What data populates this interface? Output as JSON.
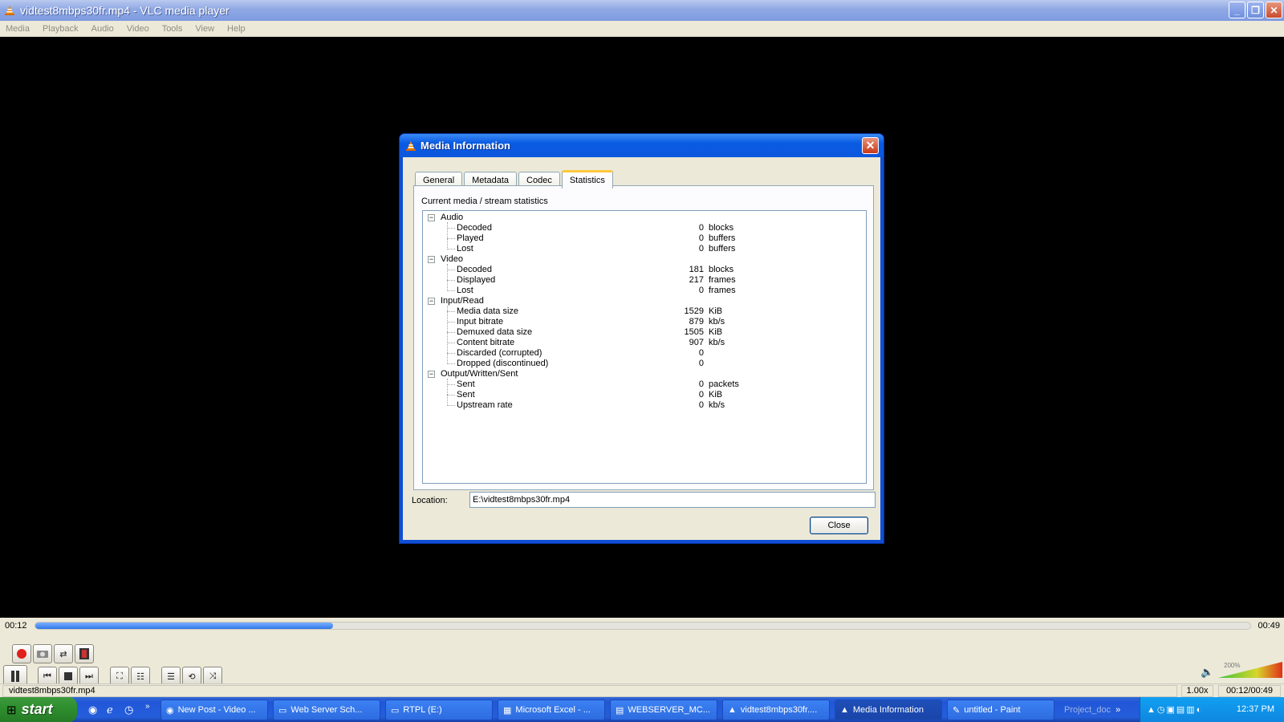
{
  "window": {
    "title": "vidtest8mbps30fr.mp4 - VLC media player"
  },
  "menu": [
    "Media",
    "Playback",
    "Audio",
    "Video",
    "Tools",
    "View",
    "Help"
  ],
  "dialog": {
    "title": "Media Information",
    "tabs": [
      "General",
      "Metadata",
      "Codec",
      "Statistics"
    ],
    "active_tab": "Statistics",
    "panel_label": "Current media / stream statistics",
    "groups": [
      {
        "label": "Audio",
        "items": [
          {
            "label": "Decoded",
            "value": "0",
            "unit": "blocks"
          },
          {
            "label": "Played",
            "value": "0",
            "unit": "buffers"
          },
          {
            "label": "Lost",
            "value": "0",
            "unit": "buffers"
          }
        ]
      },
      {
        "label": "Video",
        "items": [
          {
            "label": "Decoded",
            "value": "181",
            "unit": "blocks"
          },
          {
            "label": "Displayed",
            "value": "217",
            "unit": "frames"
          },
          {
            "label": "Lost",
            "value": "0",
            "unit": "frames"
          }
        ]
      },
      {
        "label": "Input/Read",
        "items": [
          {
            "label": "Media data size",
            "value": "1529",
            "unit": "KiB"
          },
          {
            "label": "Input bitrate",
            "value": "879",
            "unit": "kb/s"
          },
          {
            "label": "Demuxed data size",
            "value": "1505",
            "unit": "KiB"
          },
          {
            "label": "Content bitrate",
            "value": "907",
            "unit": "kb/s"
          },
          {
            "label": "Discarded (corrupted)",
            "value": "0",
            "unit": ""
          },
          {
            "label": "Dropped (discontinued)",
            "value": "0",
            "unit": ""
          }
        ]
      },
      {
        "label": "Output/Written/Sent",
        "items": [
          {
            "label": "Sent",
            "value": "0",
            "unit": "packets"
          },
          {
            "label": "Sent",
            "value": "0",
            "unit": "KiB"
          },
          {
            "label": "Upstream rate",
            "value": "0",
            "unit": "kb/s"
          }
        ]
      }
    ],
    "location_label": "Location:",
    "location_value": "E:\\vidtest8mbps30fr.mp4",
    "close_label": "Close"
  },
  "player": {
    "elapsed": "00:12",
    "total": "00:49",
    "progress": 0.245,
    "volume_label": "200%",
    "status_file": "vidtest8mbps30fr.mp4",
    "speed": "1.00x",
    "time_display": "00:12/00:49"
  },
  "taskbar": {
    "start_label": "start",
    "tasks": [
      {
        "label": "New Post - Video ...",
        "icon": "chrome-icon"
      },
      {
        "label": "Web Server Sch...",
        "icon": "folder-icon"
      },
      {
        "label": "RTPL (E:)",
        "icon": "folder-icon"
      },
      {
        "label": "Microsoft Excel - ...",
        "icon": "excel-icon"
      },
      {
        "label": "WEBSERVER_MC...",
        "icon": "pdf-icon"
      },
      {
        "label": "vidtest8mbps30fr....",
        "icon": "vlc-icon"
      },
      {
        "label": "Media Information",
        "icon": "vlc-icon",
        "active": true
      },
      {
        "label": "untitled - Paint",
        "icon": "paint-icon"
      },
      {
        "label": "Project_doc",
        "icon": ""
      }
    ],
    "clock": "12:37 PM"
  },
  "colors": {
    "accent": "#2f77e8",
    "titlebar": "#0b58de",
    "taskbar": "#245edb"
  }
}
